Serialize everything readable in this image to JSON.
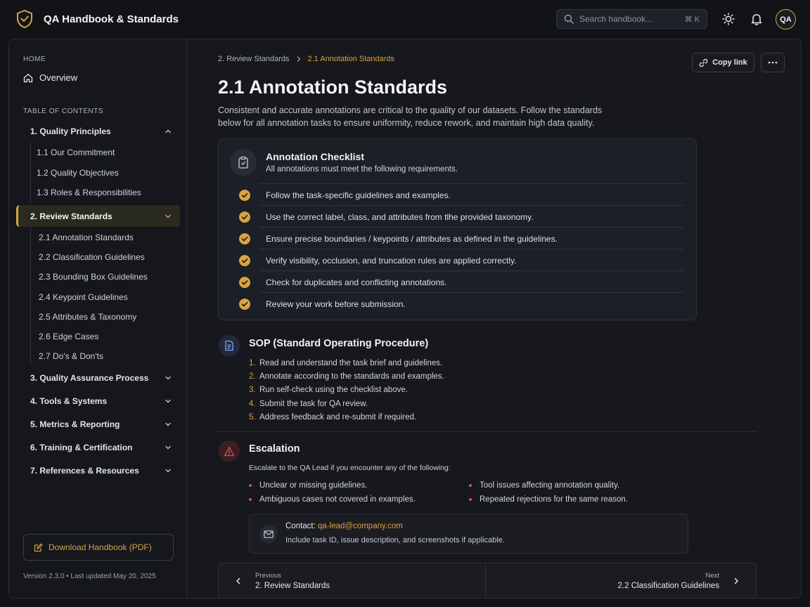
{
  "app": {
    "title": "QA Handbook & Standards",
    "logo_icon": "shield-check-icon"
  },
  "header": {
    "search_placeholder": "Search handbook...",
    "search_shortcut": "⌘ K",
    "avatar_initials": "QA"
  },
  "sidebar": {
    "home_label": "HOME",
    "overview_label": "Overview",
    "toc_label": "TABLE OF CONTENTS",
    "groups": [
      {
        "label": "1. Quality Principles",
        "expanded": true,
        "items": [
          "1.1 Our Commitment",
          "1.2 Quality Objectives",
          "1.3 Roles & Responsibilities"
        ]
      },
      {
        "label": "2. Review Standards",
        "expanded": true,
        "active": true,
        "items": [
          "2.1 Annotation Standards",
          "2.2 Classification Guidelines",
          "2.3 Bounding Box Guidelines",
          "2.4 Keypoint Guidelines",
          "2.5 Attributes & Taxonomy",
          "2.6 Edge Cases",
          "2.7 Do's & Don'ts"
        ]
      },
      {
        "label": "3. Quality Assurance Process"
      },
      {
        "label": "4. Tools & Systems"
      },
      {
        "label": "5. Metrics & Reporting"
      },
      {
        "label": "6. Training & Certification"
      },
      {
        "label": "7. References & Resources"
      }
    ],
    "download_label": "Download Handbook (PDF)",
    "version_text": "Version 2.3.0  •  Last updated May 20, 2025"
  },
  "main": {
    "breadcrumb": [
      "2. Review Standards",
      "2.1 Annotation Standards"
    ],
    "copy_link_label": "Copy link",
    "title": "2.1 Annotation Standards",
    "intro": "Consistent and accurate annotations are critical to the quality of our datasets. Follow the standards below for all annotation tasks to ensure uniformity, reduce rework, and maintain high data quality.",
    "checklist": {
      "title": "Annotation Checklist",
      "subtitle": "All annotations must meet the following requirements.",
      "items": [
        "Follow the task-specific guidelines and examples.",
        "Use the correct label, class, and attributes from tlhe provided taxonomy.",
        "Ensure precise boundaries / keypoints / attributes as defined in the guidelines.",
        "Verify visibility, occlusion, and truncation rules are applied correctly.",
        "Check for duplicates and conflicting annotations.",
        "Review your work before submission."
      ]
    },
    "sop": {
      "title": "SOP (Standard Operating Procedure)",
      "steps": [
        "Read and understand the task brief and guidelines.",
        "Annotate according to the standards and examples.",
        "Run self-check using the checklist above.",
        "Submit the task for QA review.",
        "Address feedback and re-submit if required."
      ]
    },
    "escalation": {
      "title": "Escalation",
      "intro": "Escalate to the QA Lead if you encounter any of the following:",
      "bullets_left": [
        "Unclear or missing guidelines.",
        "Ambiguous cases not covered in examples."
      ],
      "bullets_right": [
        "Tool issues affecting annotation quality.",
        "Repeated rejections for the same reason."
      ],
      "contact_label": "Contact:",
      "contact_email": "qa-lead@company.com",
      "contact_note": "Include task ID, issue description, and screenshots if applicable."
    },
    "pager": {
      "prev_label": "Previous",
      "prev_title": "2. Review Standards",
      "next_label": "Next",
      "next_title": "2.2 Classification Guidelines"
    }
  },
  "colors": {
    "accent": "#d9a441",
    "danger": "#d6524c",
    "info": "#7aa6ff",
    "background": "#111317"
  }
}
